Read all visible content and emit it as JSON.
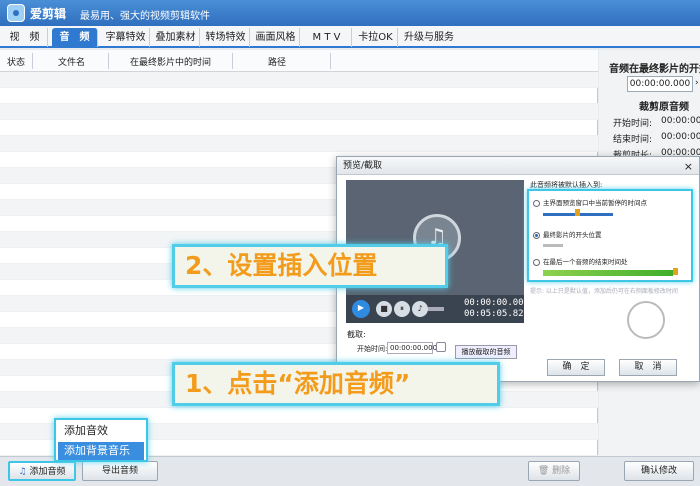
{
  "app": {
    "name": "爱剪辑",
    "slogan": "最易用、强大的视频剪辑软件"
  },
  "tabs": [
    "视　频",
    "音　频",
    "字幕特效",
    "叠加素材",
    "转场特效",
    "画面风格",
    "M T V",
    "卡拉OK",
    "升级与服务"
  ],
  "active_tab": 1,
  "columns": [
    "状态",
    "文件名",
    "在最终影片中的时间",
    "路径"
  ],
  "right_panel": {
    "title": "音频在最终影片的开始",
    "time": "00:00:00.000",
    "section": "裁剪原音频",
    "fields": [
      {
        "label": "开始时间:",
        "value": "00:00:00"
      },
      {
        "label": "结束时间:",
        "value": "00:00:00"
      },
      {
        "label": "裁剪时长:",
        "value": "00:00:00"
      }
    ]
  },
  "bottom": {
    "add_audio": "添加音频",
    "export": "导出音频",
    "delete": "删除",
    "confirm": "确认修改"
  },
  "popup_menu": [
    "添加音效",
    "添加背景音乐"
  ],
  "dialog": {
    "title": "预览/截取",
    "close": "×",
    "time_current": "00:00:00.000",
    "time_total": "00:05:05.820",
    "cut_label": "截取:",
    "start_label": "开始时间:",
    "start_value": "00:00:00.000",
    "cut_button": "播放截取的音频",
    "options_title": "此音频将被默认插入到:",
    "options": [
      "主界面预览窗口中当前暂停的时间点",
      "最终影片的开头位置",
      "在最后一个音频的结束时间处"
    ],
    "selected_option": 1,
    "tip": "提示: 以上只是默认值，添加后仍可在右侧面板修改时间",
    "ok": "确　定",
    "cancel": "取　消"
  },
  "callouts": {
    "step2": "2、设置插入位置",
    "step1": "1、点击“添加音频”"
  }
}
